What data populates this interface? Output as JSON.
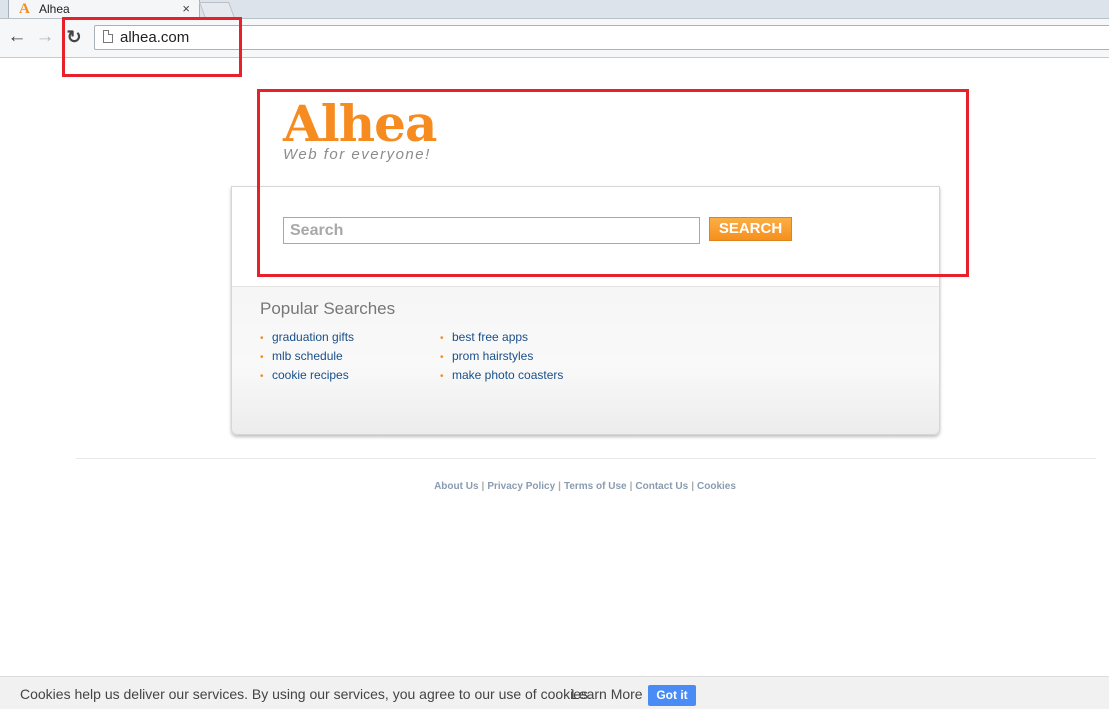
{
  "browser": {
    "tab_title": "Alhea",
    "tab_favicon": "A",
    "tab_close": "×",
    "url": "alhea.com",
    "icons": {
      "back": "back-arrow-icon",
      "forward": "forward-arrow-icon",
      "reload": "reload-icon",
      "page": "page-icon"
    }
  },
  "page": {
    "logo": "Alhea",
    "tagline": "Web for everyone!",
    "search": {
      "placeholder": "Search",
      "button_label": "SEARCH"
    },
    "popular": {
      "title": "Popular Searches",
      "column1": [
        "graduation gifts",
        "mlb schedule",
        "cookie recipes"
      ],
      "column2": [
        "best free apps",
        "prom hairstyles",
        "make photo coasters"
      ]
    },
    "footer": {
      "links": [
        "About Us",
        "Privacy Policy",
        "Terms of Use",
        "Contact Us",
        "Cookies"
      ],
      "separator": "|"
    }
  },
  "cookie_bar": {
    "message": "Cookies help us deliver our services. By using our services, you agree to our use of cookies.",
    "learn_more": "Learn More",
    "got_it": "Got it"
  },
  "colors": {
    "brand_orange": "#f68b1f",
    "annotation_red": "#e8202a",
    "link_blue": "#1a4f8a",
    "got_it_blue": "#4a8cf6"
  }
}
